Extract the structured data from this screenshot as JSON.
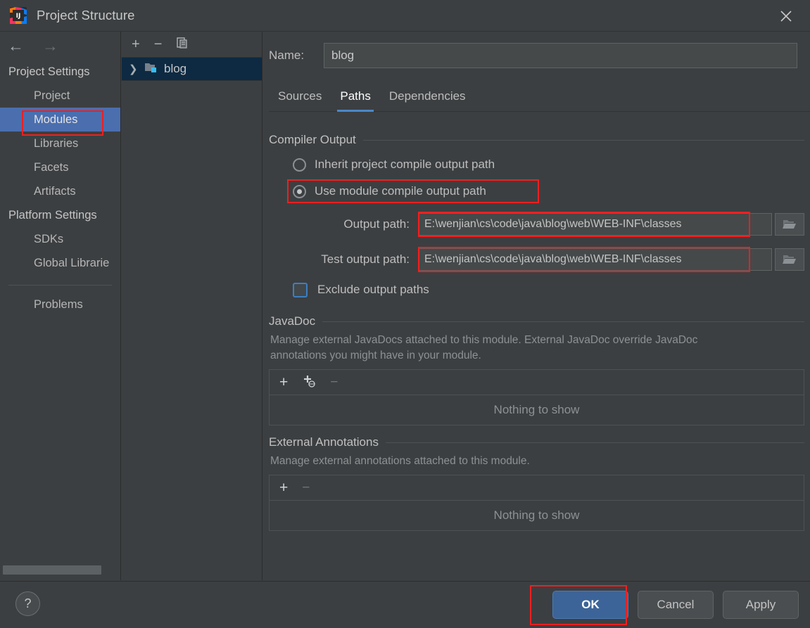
{
  "window": {
    "title": "Project Structure",
    "logo_icon": "intellij-idea-logo",
    "close_icon": "close-icon"
  },
  "sidebar": {
    "back_icon": "arrow-left-icon",
    "forward_icon": "arrow-right-icon",
    "groups": [
      {
        "label": "Project Settings",
        "items": [
          {
            "label": "Project",
            "selected": false
          },
          {
            "label": "Modules",
            "selected": true
          },
          {
            "label": "Libraries",
            "selected": false
          },
          {
            "label": "Facets",
            "selected": false
          },
          {
            "label": "Artifacts",
            "selected": false
          }
        ]
      },
      {
        "label": "Platform Settings",
        "items": [
          {
            "label": "SDKs",
            "selected": false
          },
          {
            "label": "Global Librarie",
            "selected": false
          }
        ]
      }
    ],
    "problems_label": "Problems"
  },
  "module_panel": {
    "toolbar": {
      "add_icon": "plus-icon",
      "remove_icon": "minus-icon",
      "copy_icon": "copy-icon"
    },
    "tree": [
      {
        "label": "blog",
        "chevron_icon": "chevron-right-icon",
        "folder_icon": "module-folder-icon",
        "selected": true
      }
    ]
  },
  "main": {
    "name_label": "Name:",
    "name_value": "blog",
    "name_placeholder": "",
    "tabs": [
      {
        "label": "Sources",
        "active": false
      },
      {
        "label": "Paths",
        "active": true
      },
      {
        "label": "Dependencies",
        "active": false
      }
    ],
    "compiler_output": {
      "section_title": "Compiler Output",
      "radios": [
        {
          "label": "Inherit project compile output path",
          "checked": false
        },
        {
          "label": "Use module compile output path",
          "checked": true,
          "highlighted": true
        }
      ],
      "paths": [
        {
          "label": "Output path:",
          "value": "E:\\wenjian\\cs\\code\\java\\blog\\web\\WEB-INF\\classes",
          "browse_icon": "folder-open-icon",
          "highlighted": true
        },
        {
          "label": "Test output path:",
          "value": "E:\\wenjian\\cs\\code\\java\\blog\\web\\WEB-INF\\classes",
          "browse_icon": "folder-open-icon",
          "highlighted": true
        }
      ],
      "exclude_checkbox": {
        "label": "Exclude output paths",
        "checked": false
      }
    },
    "javadoc": {
      "section_title": "JavaDoc",
      "description": "Manage external JavaDocs attached to this module. External JavaDoc override JavaDoc annotations you might have in your module.",
      "toolbar": {
        "add_icon": "plus-icon",
        "add_url_icon": "plus-globe-icon",
        "remove_icon": "minus-icon"
      },
      "empty_text": "Nothing to show"
    },
    "external_annotations": {
      "section_title": "External Annotations",
      "description": "Manage external annotations attached to this module.",
      "toolbar": {
        "add_icon": "plus-icon",
        "remove_icon": "minus-icon"
      },
      "empty_text": "Nothing to show"
    }
  },
  "footer": {
    "help_label": "?",
    "buttons": [
      {
        "label": "OK",
        "primary": true,
        "highlighted": true
      },
      {
        "label": "Cancel",
        "primary": false,
        "highlighted": false
      },
      {
        "label": "Apply",
        "primary": false,
        "highlighted": false
      }
    ]
  },
  "colors": {
    "background": "#3c3f41",
    "selection_blue": "#4b6eaf",
    "tree_selection": "#0d2a42",
    "accent_tab": "#4a88c7",
    "highlight_red": "#f01f1f",
    "primary_button": "#3c6498"
  }
}
